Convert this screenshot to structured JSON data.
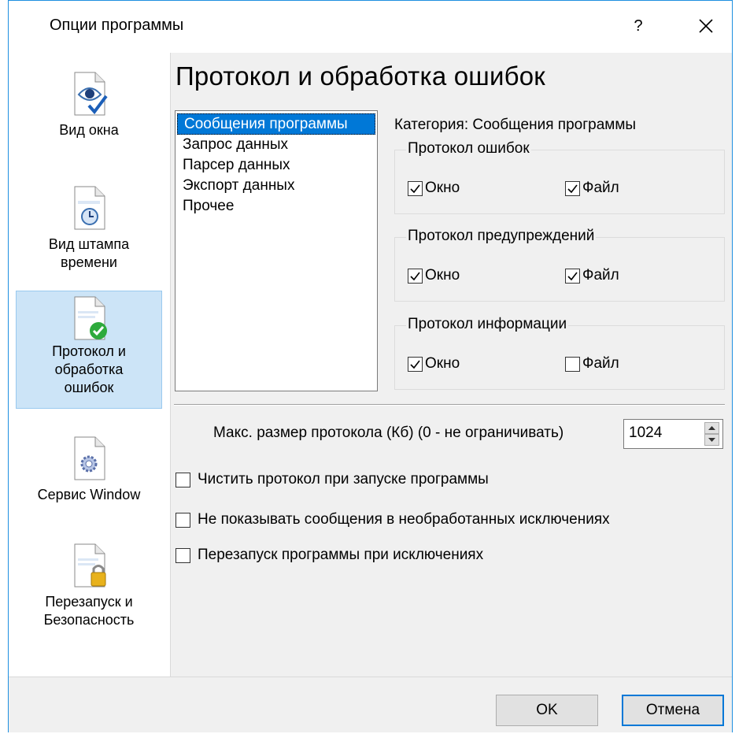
{
  "window": {
    "title": "Опции программы",
    "help_label": "?"
  },
  "sidebar": {
    "items": [
      {
        "label": "Вид окна",
        "icon": "document-eye-icon",
        "selected": false
      },
      {
        "label": "Вид штампа\nвремени",
        "icon": "document-clock-icon",
        "selected": false
      },
      {
        "label": "Протокол и\nобработка\nошибок",
        "icon": "document-check-icon",
        "selected": true
      },
      {
        "label": "Сервис Window",
        "icon": "document-gear-icon",
        "selected": false
      },
      {
        "label": "Перезапуск и\nБезопасность",
        "icon": "document-lock-icon",
        "selected": false
      }
    ]
  },
  "page": {
    "title": "Протокол и обработка ошибок"
  },
  "categories": {
    "items": [
      "Сообщения программы",
      "Запрос данных",
      "Парсер данных",
      "Экспорт данных",
      "Прочее"
    ],
    "selected_index": 0
  },
  "category_label": "Категория: Сообщения программы",
  "groups": [
    {
      "legend": "Протокол ошибок",
      "window_label": "Окно",
      "window_checked": true,
      "file_label": "Файл",
      "file_checked": true
    },
    {
      "legend": "Протокол предупреждений",
      "window_label": "Окно",
      "window_checked": true,
      "file_label": "Файл",
      "file_checked": true
    },
    {
      "legend": "Протокол информации",
      "window_label": "Окно",
      "window_checked": true,
      "file_label": "Файл",
      "file_checked": false
    }
  ],
  "max_size": {
    "label": "Макс. размер протокола (Кб) (0 - не ограничивать)",
    "value": "1024"
  },
  "options": [
    {
      "label": "Чистить протокол при запуске программы",
      "checked": false
    },
    {
      "label": "Не показывать сообщения в необработанных исключениях",
      "checked": false
    },
    {
      "label": "Перезапуск программы при исключениях",
      "checked": false
    }
  ],
  "buttons": {
    "ok": "OK",
    "cancel": "Отмена"
  },
  "colors": {
    "accent": "#0078d7",
    "selection_bg": "#cce4f7",
    "dialog_bg": "#f0f0f0",
    "check_green": "#2eaa3c",
    "lock_gold": "#e8b21c"
  }
}
